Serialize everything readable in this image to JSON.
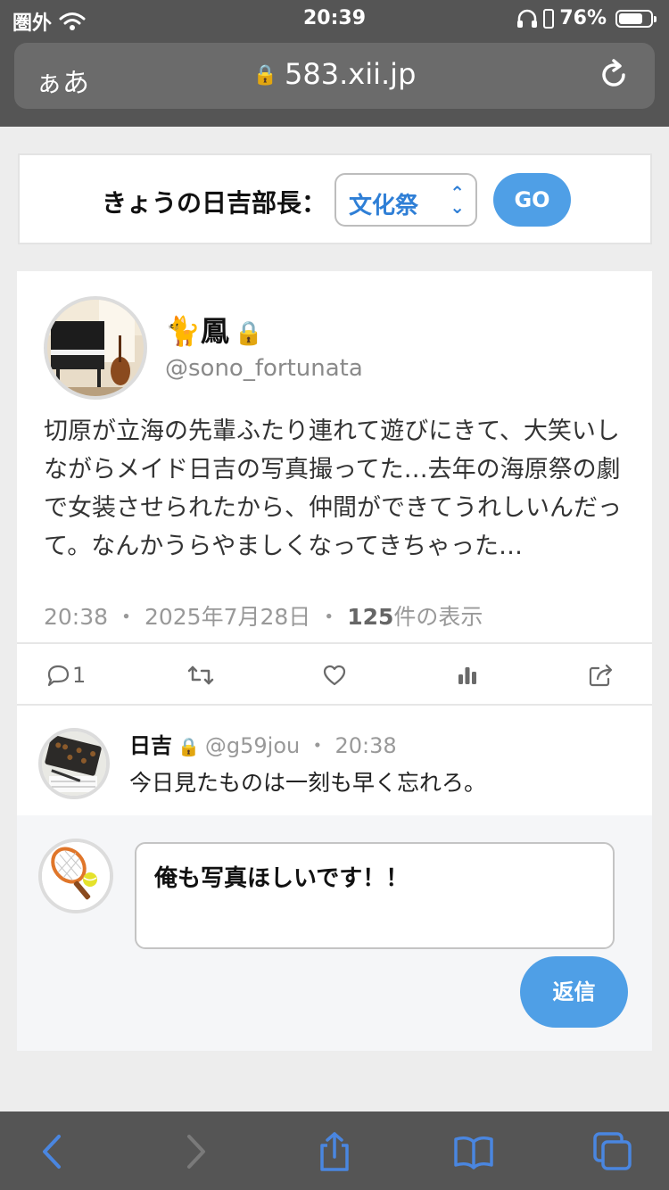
{
  "status_bar": {
    "carrier": "圏外",
    "time": "20:39",
    "battery": "76%",
    "battery_level": 0.76
  },
  "browser": {
    "aa_label": "ぁあ",
    "url": "583.xii.jp"
  },
  "selector": {
    "label": "きょうの日吉部長：",
    "selected": "文化祭",
    "go_label": "GO"
  },
  "tweet": {
    "name": "🐈鳳",
    "handle": "@sono_fortunata",
    "body": "切原が立海の先輩ふたり連れて遊びにきて、大笑いしながらメイド日吉の写真撮ってた…去年の海原祭の劇で女装させられたから、仲間ができてうれしいんだって。なんかうらやましくなってきちゃった…",
    "time": "20:38",
    "date": "2025年7月28日",
    "views_count": "125",
    "views_suffix": "件の表示",
    "reply_count": "1"
  },
  "reply": {
    "name": "日吉",
    "handle": "@g59jou",
    "time": "20:38",
    "text": "今日見たものは一刻も早く忘れろ。"
  },
  "compose": {
    "text": "俺も写真ほしいです！！",
    "button_label": "返信"
  },
  "colors": {
    "accent": "#4f9fe6",
    "link_text": "#2f7fd6",
    "chrome": "#555555"
  }
}
